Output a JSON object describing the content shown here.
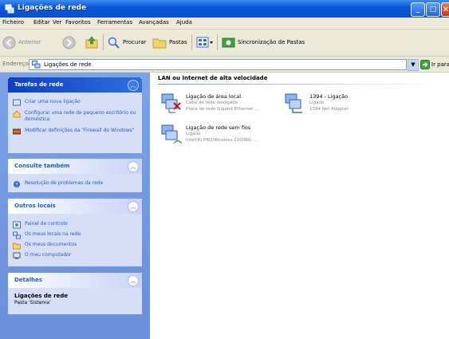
{
  "window": {
    "title": "Ligações de rede"
  },
  "menu": [
    "Ficheiro",
    "Editar",
    "Ver",
    "Favoritos",
    "Ferramentas",
    "Avançadas",
    "Ajuda"
  ],
  "toolbar": {
    "back_label": "Anterior",
    "search_label": "Procurar",
    "folders_label": "Pastas",
    "network_label": "Sincronização de Pastas"
  },
  "address": {
    "label": "Endereço",
    "value": "Ligações de rede",
    "go_label": "Ir para"
  },
  "left": {
    "network_tasks": {
      "title": "Tarefas de rede",
      "items": [
        "Criar uma nova ligação",
        "Configurar uma rede de pequeno escritório ou doméstica",
        "Modificar definições da \"Firewall do Windows\""
      ]
    },
    "see_also": {
      "title": "Consulte também",
      "items": [
        "Resolução de problemas da rede"
      ]
    },
    "other_places": {
      "title": "Outros locais",
      "items": [
        "Painel de controlo",
        "Os meus locais na rede",
        "Os meus documentos",
        "O meu computador"
      ]
    },
    "details": {
      "title": "Detalhes",
      "name": "Ligações de rede",
      "sub": "Pasta 'Sistema'"
    }
  },
  "content": {
    "group_title": "LAN ou Internet de alta velocidade",
    "connections": [
      {
        "name": "Ligação de área local",
        "line1": "Cabo de rede desligado",
        "line2": "Placa de rede Gigabit Ethernet ..."
      },
      {
        "name": "1394 - Ligação",
        "line1": "Ligado",
        "line2": "1394 Net Adapter"
      },
      {
        "name": "Ligação de rede sem fios",
        "line1": "Ligado",
        "line2": "Intel(R) PRO/Wireless 2200BG ..."
      }
    ]
  },
  "colors": {
    "titlebar": "#0b58d9",
    "left_panel": "#7ba2e7",
    "link": "#215dc6",
    "chrome": "#ece9d8"
  }
}
